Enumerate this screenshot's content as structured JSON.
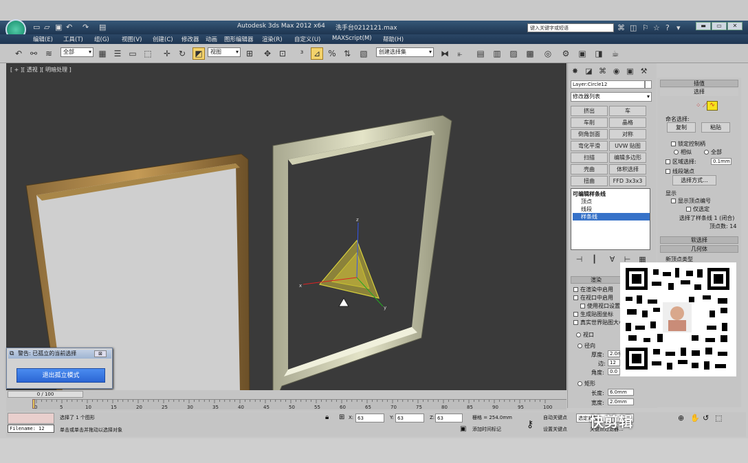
{
  "app": {
    "title": "Autodesk 3ds Max 2012 x64",
    "file": "洗手台0212121.max",
    "search_placeholder": "键入关键字或短语"
  },
  "menu": [
    "编辑(E)",
    "工具(T)",
    "组(G)",
    "视图(V)",
    "创建(C)",
    "修改器",
    "动画",
    "图形编辑器",
    "渲染(R)",
    "自定义(U)",
    "MAXScript(M)",
    "帮助(H)"
  ],
  "toolbar": {
    "filter_label": "全部",
    "refcoord_label": "视图",
    "named_sel_label": "创建选择集"
  },
  "viewport": {
    "label": "[ + ][ 透视 ][ 明暗处理 ]",
    "gizmo_axes": {
      "x": "x",
      "y": "y",
      "z": "z"
    }
  },
  "command_panel": {
    "object_name": "Layer:Circle12",
    "modifier_list": "修改器列表",
    "modifier_buttons": [
      "挤出",
      "车",
      "车削",
      "晶格",
      "倒角剖面",
      "对称",
      "弯化平滑",
      "UVW 贴图",
      "扫描",
      "编辑多边形",
      "壳曲",
      "体积选择",
      "扭曲",
      "FFD 3x3x3"
    ],
    "stack": [
      "可编辑样条线",
      "顶点",
      "线段",
      "样条线"
    ],
    "stack_selected": "样条线"
  },
  "rollout": {
    "insert_header": "插值",
    "select_header": "选择",
    "named_sel": "命名选择:",
    "copy": "复制",
    "paste": "粘贴",
    "lock_handles": "锁定控制柄",
    "alike": "相似",
    "all": "全部",
    "area_select": "区域选择:",
    "area_value": "0.1mm",
    "segment_end": "线段端点",
    "select_by": "选择方式...",
    "display_header": "显示",
    "show_vertex_numbers": "显示顶点编号",
    "only_selected": "仅选定",
    "selected_info": "选择了样条线 1 (闭合)",
    "vertex_count": "顶点数: 14",
    "soft_select": "软选择",
    "geometry": "几何体",
    "new_vertex_type": "新顶点类型"
  },
  "render_rollout": {
    "header": "渲染",
    "enable_in_renderer": "在渲染中启用",
    "enable_in_viewport": "在视口中启用",
    "use_viewport_settings": "使用视口设置",
    "gen_mapping": "生成贴图坐标",
    "real_world": "真实世界贴图大小",
    "viewport": "视口",
    "renderer": "渲染",
    "radial": "径向",
    "thickness": "厚度:",
    "thickness_value": "2.0mm",
    "sides": "边:",
    "sides_value": "12",
    "angle": "角度:",
    "angle_value": "0.0",
    "rectangular": "矩形",
    "length": "长度:",
    "length_value": "6.0mm",
    "width": "宽度:",
    "width_value": "2.0mm"
  },
  "warning": {
    "title": "警告: 已孤立的当前选择",
    "button": "退出孤立模式",
    "close": "⊠"
  },
  "timeline": {
    "slider": "0 / 100",
    "ticks": [
      "0",
      "5",
      "10",
      "15",
      "20",
      "25",
      "30",
      "35",
      "40",
      "45",
      "50",
      "55",
      "60",
      "65",
      "70",
      "75",
      "80",
      "85",
      "90",
      "95",
      "100"
    ]
  },
  "status": {
    "line1": "选择了 1 个图形",
    "line2": "单击或单击并拖动以选择对象",
    "filename": "Filename: 12",
    "x_label": "X:",
    "x_value": "63",
    "y_label": "Y:",
    "y_value": "63",
    "z_label": "Z:",
    "z_value": "63",
    "grid": "栅格 = 254.0mm",
    "add_time_tag": "添加时间标记",
    "auto_key": "自动关键点",
    "selected_obj": "选定对象",
    "set_key": "设置关键点",
    "key_filters": "关键点过滤器..."
  },
  "watermark": {
    "brand": "快剪辑"
  },
  "colors": {
    "title_bg": "#1e3550",
    "viewport_bg": "#3a3a3a",
    "selection": "#3672c8",
    "warning_btn": "#2c66d4",
    "active_tool": "#f3d26b"
  }
}
